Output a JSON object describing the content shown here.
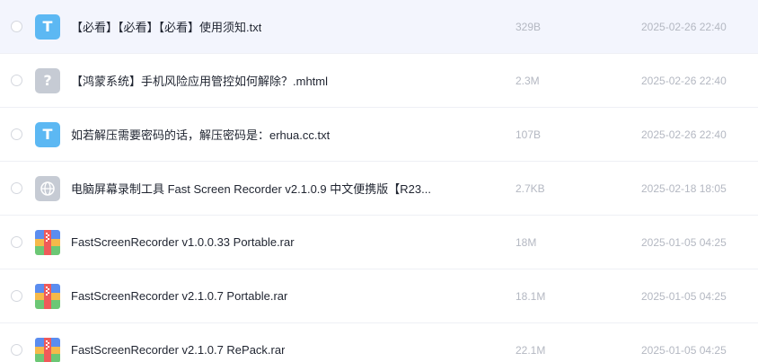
{
  "files": [
    {
      "name": "【必看】【必看】【必看】使用须知.txt",
      "size": "329B",
      "date": "2025-02-26 22:40",
      "icon": "txt-file-icon",
      "icon_glyph": "T"
    },
    {
      "name": "【鸿蒙系统】手机风险应用管控如何解除？.mhtml",
      "size": "2.3M",
      "date": "2025-02-26 22:40",
      "icon": "unknown-file-icon",
      "icon_glyph": "?"
    },
    {
      "name": "如若解压需要密码的话，解压密码是：erhua.cc.txt",
      "size": "107B",
      "date": "2025-02-26 22:40",
      "icon": "txt-file-icon",
      "icon_glyph": "T"
    },
    {
      "name": "电脑屏幕录制工具 Fast Screen Recorder v2.1.0.9 中文便携版【R23...",
      "size": "2.7KB",
      "date": "2025-02-18 18:05",
      "icon": "web-link-icon"
    },
    {
      "name": "FastScreenRecorder v1.0.0.33 Portable.rar",
      "size": "18M",
      "date": "2025-01-05 04:25",
      "icon": "archive-icon"
    },
    {
      "name": "FastScreenRecorder v2.1.0.7 Portable.rar",
      "size": "18.1M",
      "date": "2025-01-05 04:25",
      "icon": "archive-icon"
    },
    {
      "name": "FastScreenRecorder v2.1.0.7 RePack.rar",
      "size": "22.1M",
      "date": "2025-01-05 04:25",
      "icon": "archive-icon"
    }
  ],
  "colors": {
    "selected_row_bg": "#f3f5fd",
    "txt_icon": "#5cb8f3",
    "generic_icon": "#c6cbd4",
    "secondary_text": "#b4b8c2"
  }
}
